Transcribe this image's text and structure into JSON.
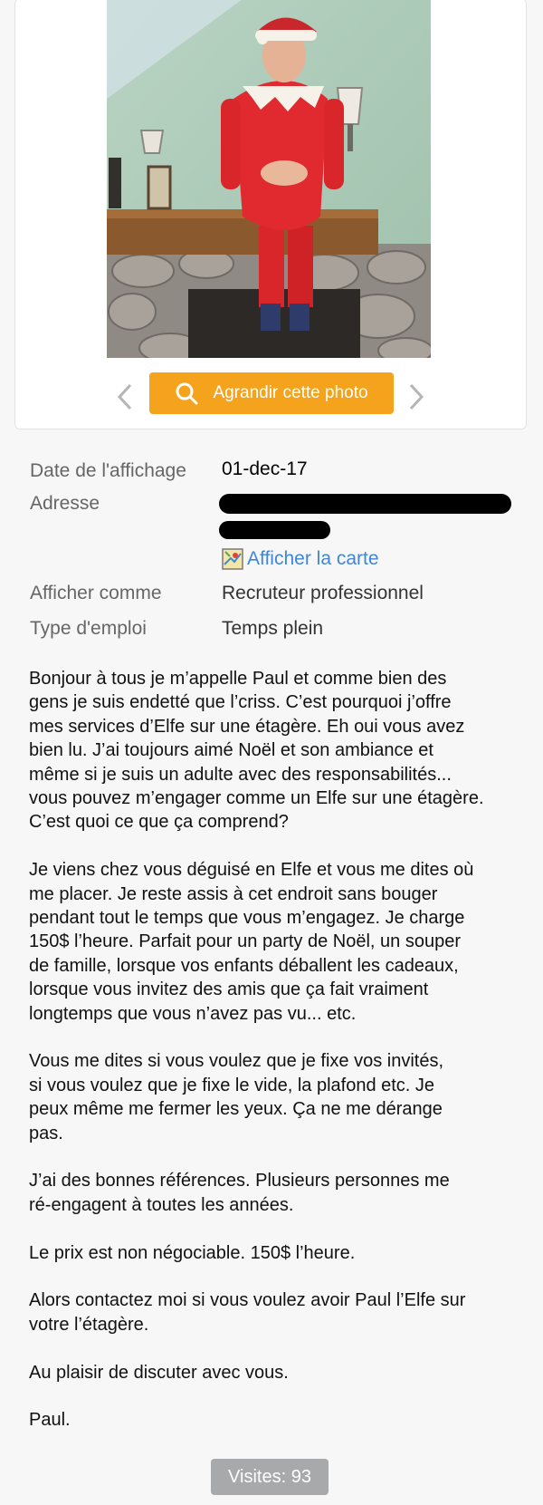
{
  "photo": {
    "enlarge_label": "Agrandir cette photo",
    "prev_icon": "chevron-left-icon",
    "next_icon": "chevron-right-icon",
    "accent_color": "#f5a31d"
  },
  "details": {
    "date_label": "Date de l'affichage",
    "date_value": "01-dec-17",
    "address_label": "Adresse",
    "map_link": "Afficher la carte",
    "post_as_label": "Afficher comme",
    "post_as_value": "Recruteur professionnel",
    "job_type_label": "Type d'emploi",
    "job_type_value": "Temps plein"
  },
  "description": {
    "paragraphs": [
      "Bonjour à tous je m’appelle Paul et comme bien des\ngens je suis endetté que l’criss. C’est pourquoi j’offre\nmes services d’Elfe sur une étagère. Eh oui vous avez\nbien lu. J’ai toujours aimé Noël et son ambiance et\nmême si je suis un adulte avec des responsabilités...\nvous pouvez m’engager comme un Elfe sur une étagère.\nC’est quoi ce que ça comprend?",
      "Je viens chez vous déguisé en Elfe et vous me dites où\nme placer. Je reste assis à cet endroit sans bouger\npendant tout le temps que vous m’engagez. Je charge\n150$ l’heure. Parfait pour un party de Noël, un souper\nde famille, lorsque vos enfants déballent les cadeaux,\nlorsque vous invitez des amis que ça fait vraiment\nlongtemps que vous n’avez pas vu... etc.",
      "Vous me dites si vous voulez que je fixe vos invités,\nsi vous voulez que je fixe le vide, la plafond etc. Je\npeux même me fermer les yeux. Ça ne me dérange\npas.",
      "J’ai des bonnes références. Plusieurs personnes me\nré-engagent à toutes les années.",
      "Le prix est non négociable. 150$ l’heure.",
      "Alors contactez moi si vous voulez avoir Paul l’Elfe sur\nvotre l’étagère.",
      "Au plaisir de discuter avec vous.",
      "Paul."
    ]
  },
  "visits": "Visites: 93"
}
